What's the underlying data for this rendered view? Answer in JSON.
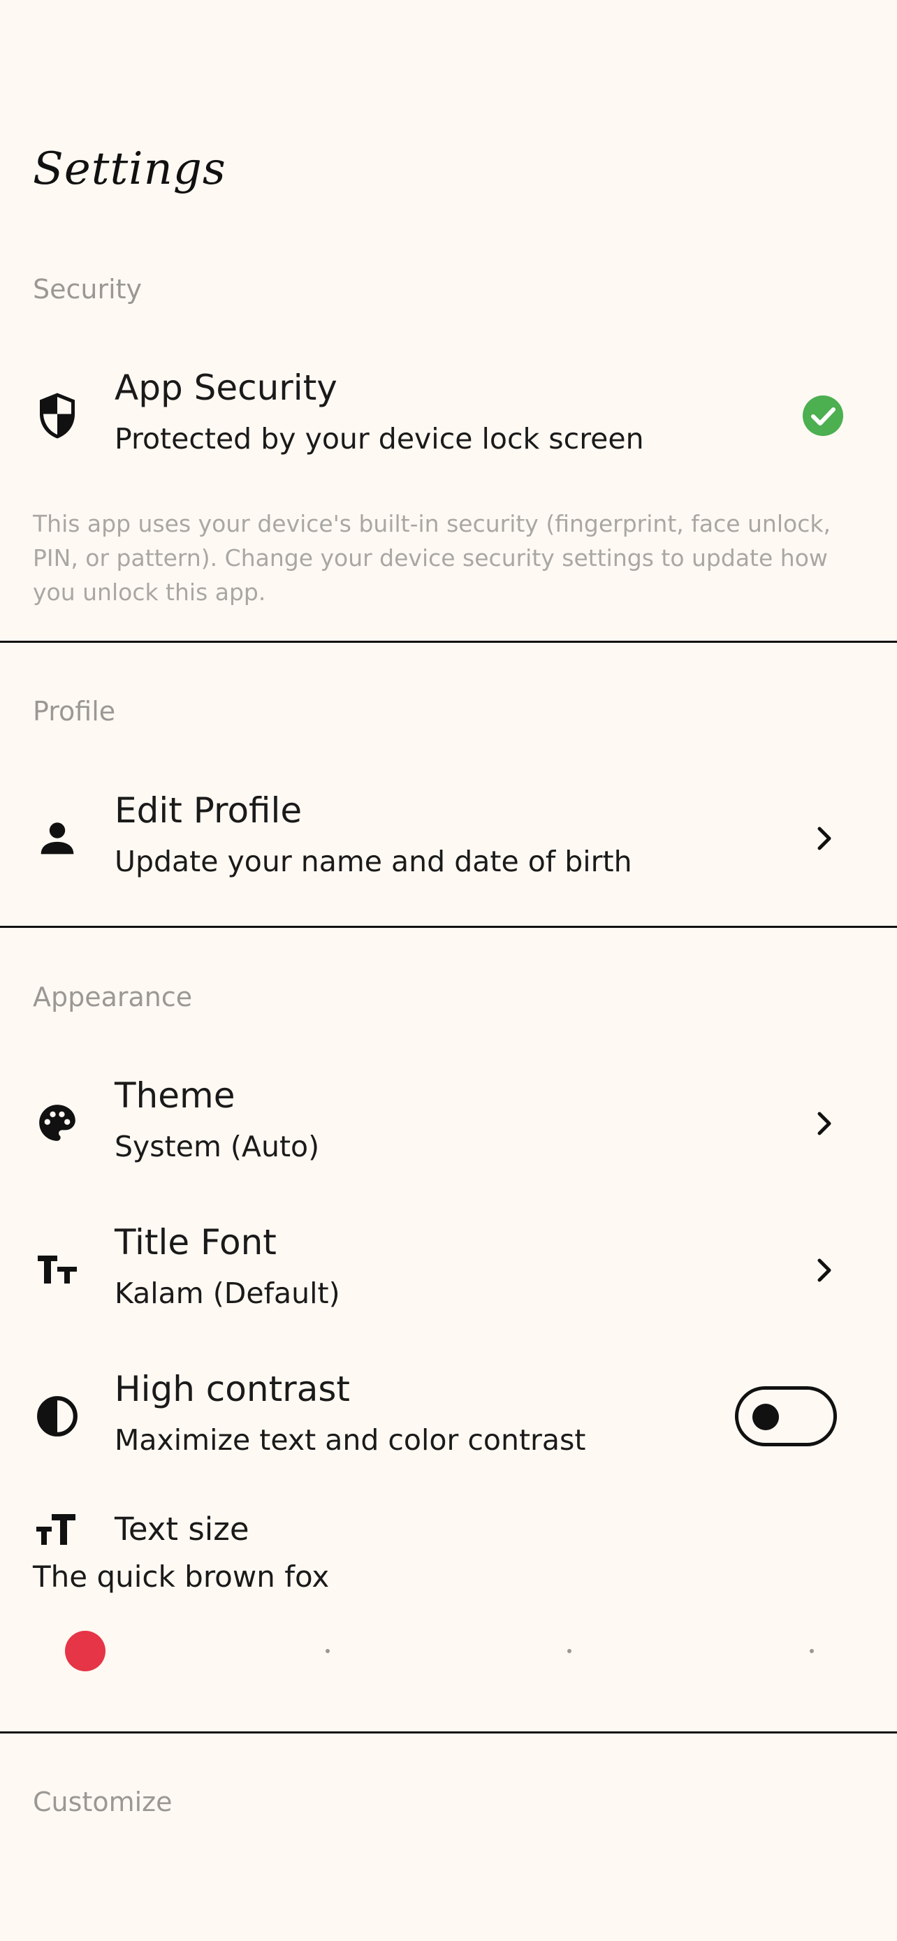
{
  "page": {
    "title": "Settings"
  },
  "security": {
    "header": "Security",
    "app_security": {
      "title": "App Security",
      "subtitle": "Protected by your device lock screen",
      "status_icon": "check-circle-icon",
      "status_color": "#4CAF50"
    },
    "note": "This app uses your device's built-in security (fingerprint, face unlock, PIN, or pattern). Change your device security settings to update how you unlock this app."
  },
  "profile": {
    "header": "Profile",
    "edit_profile": {
      "title": "Edit Profile",
      "subtitle": "Update your name and date of birth"
    }
  },
  "appearance": {
    "header": "Appearance",
    "theme": {
      "title": "Theme",
      "subtitle": "System (Auto)"
    },
    "title_font": {
      "title": "Title Font",
      "subtitle": "Kalam (Default)"
    },
    "high_contrast": {
      "title": "High contrast",
      "subtitle": "Maximize text and color contrast",
      "enabled": false
    },
    "text_size": {
      "title": "Text size",
      "preview": "The quick brown fox",
      "steps": 4,
      "selected_index": 0,
      "thumb_color": "#E53546"
    }
  },
  "customize": {
    "header": "Customize"
  }
}
